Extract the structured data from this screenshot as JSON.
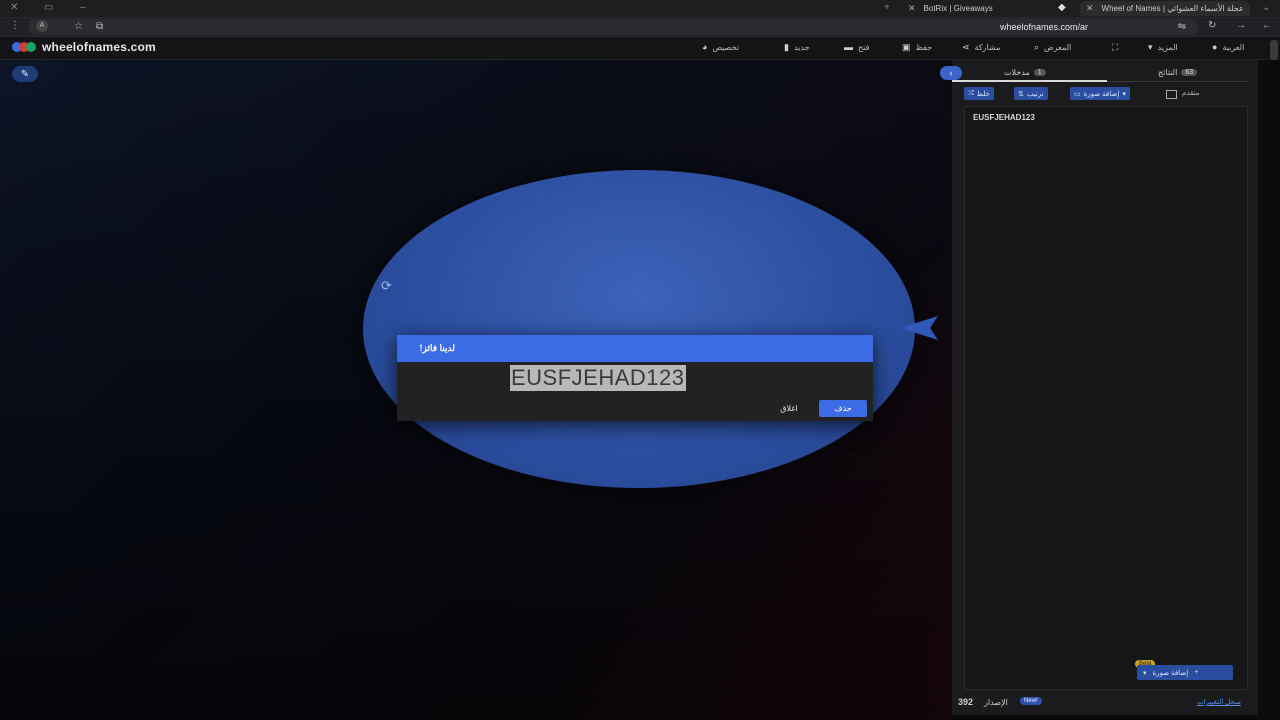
{
  "browser": {
    "tabs": [
      {
        "label": "BotRix | Giveaways"
      },
      {
        "label": "Wheel of Names | عجلة الأسماء العشوائي",
        "active": true
      }
    ],
    "url": "wheelofnames.com/ar"
  },
  "nav": {
    "site_name": "wheelofnames.com",
    "items": [
      {
        "label": "العربية",
        "icon": "globe-icon"
      },
      {
        "label": "المزيد",
        "icon": "caret-down-icon"
      },
      {
        "label": "",
        "icon": "fullscreen-icon"
      },
      {
        "label": "المعرض",
        "icon": "search-icon"
      },
      {
        "label": "مشاركة",
        "icon": "share-icon"
      },
      {
        "label": "حفظ",
        "icon": "save-icon"
      },
      {
        "label": "فتح",
        "icon": "folder-icon"
      },
      {
        "label": "جديد",
        "icon": "file-icon"
      },
      {
        "label": "تخصيص",
        "icon": "palette-icon"
      }
    ],
    "logo_colors": [
      "#3b6ce6",
      "#d23f31",
      "#1aa260"
    ]
  },
  "dialog": {
    "title": "لدينا فائز!",
    "winner": "EUSFJEHAD123",
    "remove_label": "حذف",
    "close_label": "اغلاق",
    "accent": "#3b6ce6"
  },
  "panel": {
    "tabs": [
      {
        "label": "مدخلات",
        "count": "1"
      },
      {
        "label": "النتائج",
        "count": "63"
      }
    ],
    "toolbar": {
      "shuffle": "خلط",
      "sort": "ترتيب",
      "add_image": "إضافة صورة",
      "advanced": "متقدم"
    },
    "entries": [
      "EUSFJEHAD123"
    ],
    "add_image_bottom": "إضافة صورة",
    "beta": "Beta",
    "version_number": "392",
    "version_label": "الإصدار",
    "new_badge": "New!",
    "changelog": "سجل التغييرات"
  }
}
